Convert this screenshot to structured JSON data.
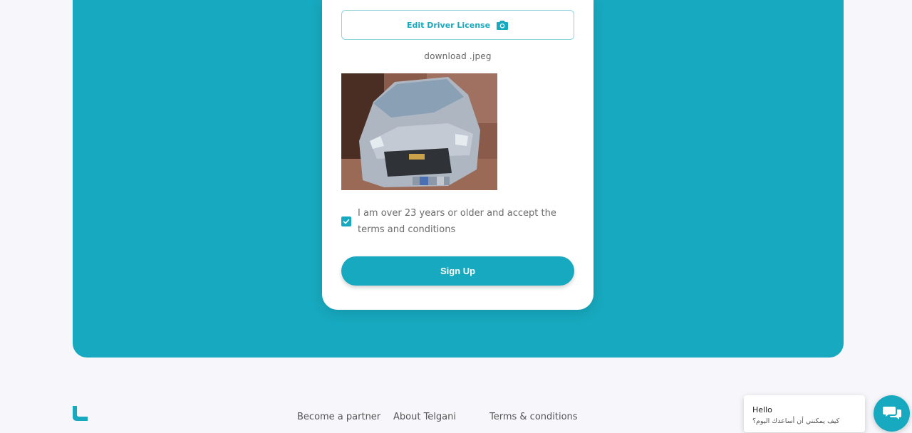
{
  "form": {
    "edit_license_label": "Edit Driver License",
    "file_name": "download .jpeg",
    "terms_text": "I am over 23 years or older and accept the terms and conditions",
    "terms_checked": true,
    "signup_label": "Sign Up"
  },
  "footer": {
    "links": [
      "Become a partner",
      "About Telgani",
      "Terms & conditions"
    ]
  },
  "chat": {
    "title": "Hello",
    "subtitle": "كيف يمكنني أن أساعدك اليوم؟"
  },
  "colors": {
    "brand": "#17a9bf",
    "background": "#f7f7fb"
  },
  "icons": {
    "license_button": "camera-icon",
    "checkbox": "checkmark-icon",
    "chat": "chat-bubbles-icon",
    "logo": "telgani-logo-icon"
  }
}
